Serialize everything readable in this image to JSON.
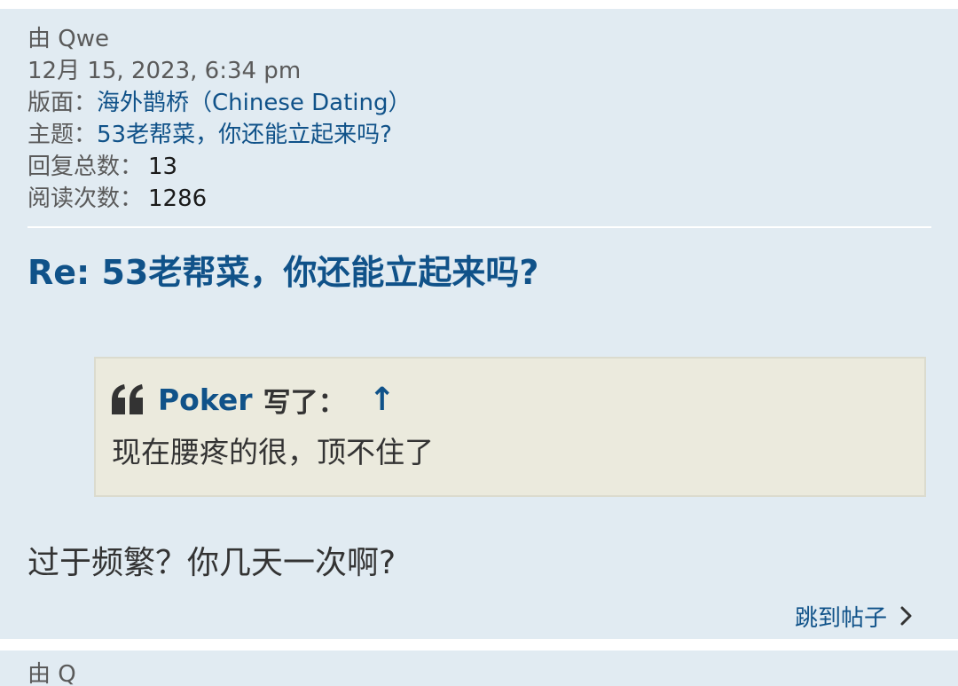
{
  "meta": {
    "author_label": "由 Qwe",
    "datetime": "12月 15, 2023, 6:34 pm",
    "forum_label": "版面：",
    "forum_name": "海外鹊桥（Chinese Dating）",
    "topic_label": "主题：",
    "topic_name": "53老帮菜，你还能立起来吗?",
    "replies_label": "回复总数：",
    "replies_count": "13",
    "views_label": "阅读次数：",
    "views_count": "1286"
  },
  "post": {
    "title": "Re: 53老帮菜，你还能立起来吗?",
    "quote": {
      "author": "Poker",
      "wrote_label": "写了：",
      "up_arrow": "↑",
      "text": "现在腰疼的很，顶不住了"
    },
    "body": "过于频繁？你几天一次啊?",
    "jump_label": "跳到帖子"
  },
  "next_post": {
    "peek_text": "由 Q"
  },
  "colors": {
    "card_bg": "#e1ebf2",
    "link": "#105289",
    "quote_bg": "#ebeadd",
    "text": "#333333"
  },
  "icons": {
    "quote": "quote-mark-icon",
    "chevron": "chevron-right-icon"
  }
}
